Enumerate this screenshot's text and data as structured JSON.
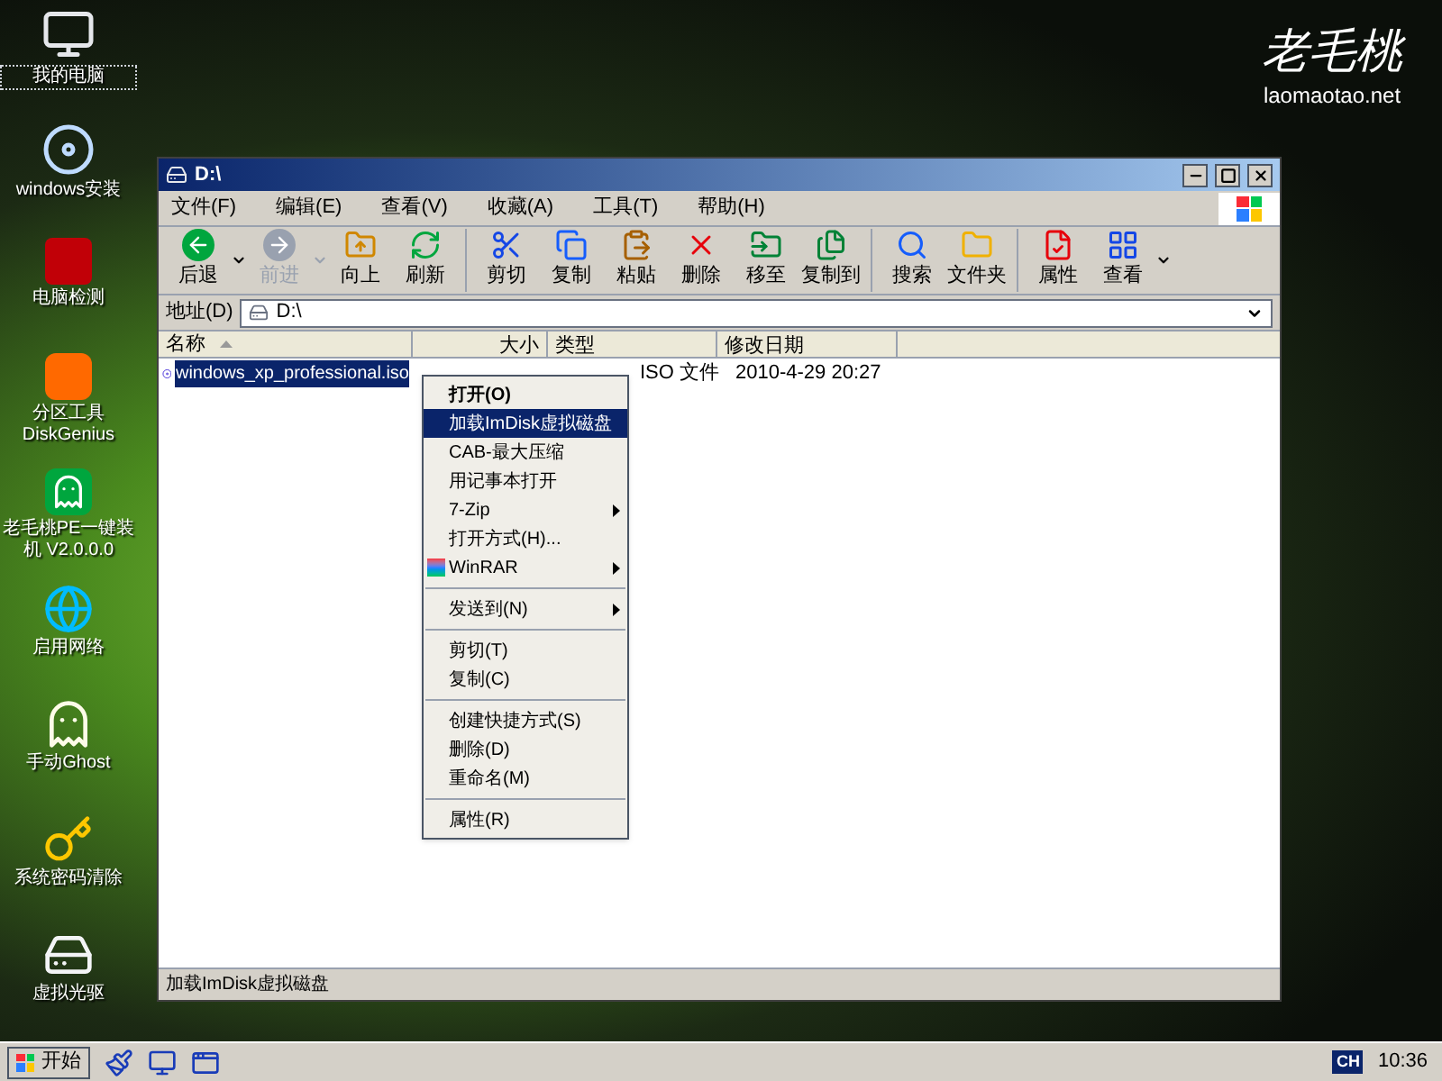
{
  "desktop": {
    "icons": [
      {
        "label": "我的电脑",
        "kind": "computer",
        "selected": true
      },
      {
        "label": "windows安装",
        "kind": "disc",
        "selected": false
      },
      {
        "label": "电脑检测",
        "kind": "sixtyfour",
        "selected": false
      },
      {
        "label": "分区工具\nDiskGenius",
        "kind": "partition",
        "selected": false
      },
      {
        "label": "老毛桃PE一键装机 V2.0.0.0",
        "kind": "ghost-green",
        "selected": false
      },
      {
        "label": "启用网络",
        "kind": "globe",
        "selected": false
      },
      {
        "label": "手动Ghost",
        "kind": "ghost",
        "selected": false
      },
      {
        "label": "系统密码清除",
        "kind": "key",
        "selected": false
      },
      {
        "label": "虚拟光驱",
        "kind": "virtual-drive",
        "selected": false
      }
    ],
    "logo": {
      "title": "老毛桃",
      "url": "laomaotao.net"
    }
  },
  "window": {
    "title": "D:\\",
    "menu": [
      "文件(F)",
      "编辑(E)",
      "查看(V)",
      "收藏(A)",
      "工具(T)",
      "帮助(H)"
    ],
    "toolbar": [
      {
        "label": "后退",
        "kind": "back",
        "disabled": false,
        "dropdown": true,
        "divider_before": false
      },
      {
        "label": "前进",
        "kind": "forward",
        "disabled": true,
        "dropdown": true,
        "divider_before": false
      },
      {
        "label": "向上",
        "kind": "up",
        "disabled": false,
        "dropdown": false,
        "divider_before": false
      },
      {
        "label": "刷新",
        "kind": "refresh",
        "disabled": false,
        "dropdown": false,
        "divider_before": false
      },
      {
        "label": "剪切",
        "kind": "cut",
        "disabled": false,
        "dropdown": false,
        "divider_before": true
      },
      {
        "label": "复制",
        "kind": "copy",
        "disabled": false,
        "dropdown": false,
        "divider_before": false
      },
      {
        "label": "粘贴",
        "kind": "paste",
        "disabled": false,
        "dropdown": false,
        "divider_before": false
      },
      {
        "label": "删除",
        "kind": "delete",
        "disabled": false,
        "dropdown": false,
        "divider_before": false
      },
      {
        "label": "移至",
        "kind": "move",
        "disabled": false,
        "dropdown": false,
        "divider_before": false
      },
      {
        "label": "复制到",
        "kind": "copyto",
        "disabled": false,
        "dropdown": false,
        "divider_before": false
      },
      {
        "label": "搜索",
        "kind": "search",
        "disabled": false,
        "dropdown": false,
        "divider_before": true
      },
      {
        "label": "文件夹",
        "kind": "folder",
        "disabled": false,
        "dropdown": false,
        "divider_before": false
      },
      {
        "label": "属性",
        "kind": "properties",
        "disabled": false,
        "dropdown": false,
        "divider_before": true
      },
      {
        "label": "查看",
        "kind": "view",
        "disabled": false,
        "dropdown": true,
        "divider_before": false
      }
    ],
    "address": {
      "label": "地址(D)",
      "value": "D:\\"
    },
    "columns": [
      "名称",
      "大小",
      "类型",
      "修改日期"
    ],
    "files": [
      {
        "name": "windows_xp_professional.iso",
        "type": "ISO 文件",
        "modified": "2010-4-29 20:27",
        "selected": true
      }
    ],
    "context_menu": [
      {
        "kind": "item",
        "label": "打开(O)",
        "default": true,
        "selected": false,
        "submenu": false
      },
      {
        "kind": "item",
        "label": "加载ImDisk虚拟磁盘",
        "default": false,
        "selected": true,
        "submenu": false
      },
      {
        "kind": "item",
        "label": "CAB-最大压缩",
        "default": false,
        "selected": false,
        "submenu": false
      },
      {
        "kind": "item",
        "label": "用记事本打开",
        "default": false,
        "selected": false,
        "submenu": false
      },
      {
        "kind": "item",
        "label": "7-Zip",
        "default": false,
        "selected": false,
        "submenu": true
      },
      {
        "kind": "item",
        "label": "打开方式(H)...",
        "default": false,
        "selected": false,
        "submenu": false
      },
      {
        "kind": "winrar",
        "label": "WinRAR",
        "default": false,
        "selected": false,
        "submenu": true
      },
      {
        "kind": "separator"
      },
      {
        "kind": "item",
        "label": "发送到(N)",
        "default": false,
        "selected": false,
        "submenu": true
      },
      {
        "kind": "separator"
      },
      {
        "kind": "item",
        "label": "剪切(T)",
        "default": false,
        "selected": false,
        "submenu": false
      },
      {
        "kind": "item",
        "label": "复制(C)",
        "default": false,
        "selected": false,
        "submenu": false
      },
      {
        "kind": "separator"
      },
      {
        "kind": "item",
        "label": "创建快捷方式(S)",
        "default": false,
        "selected": false,
        "submenu": false
      },
      {
        "kind": "item",
        "label": "删除(D)",
        "default": false,
        "selected": false,
        "submenu": false
      },
      {
        "kind": "item",
        "label": "重命名(M)",
        "default": false,
        "selected": false,
        "submenu": false
      },
      {
        "kind": "separator"
      },
      {
        "kind": "item",
        "label": "属性(R)",
        "default": false,
        "selected": false,
        "submenu": false
      }
    ],
    "status_bar": "加载ImDisk虚拟磁盘"
  },
  "taskbar": {
    "start": "开始",
    "tray": {
      "ime": "CH",
      "clock": "10:36"
    }
  }
}
